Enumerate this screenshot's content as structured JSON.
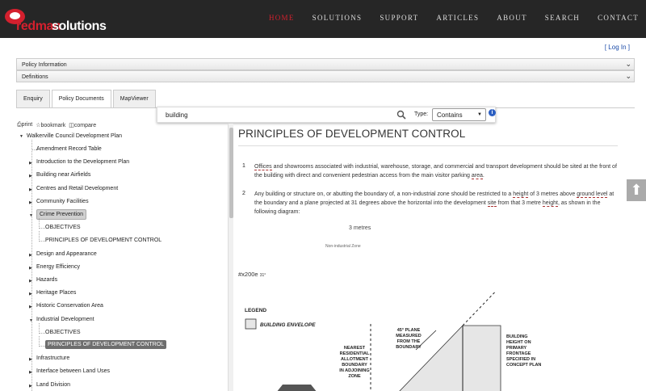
{
  "brand": {
    "red": "redman",
    "white": "solutions",
    "accent": "#d4202e"
  },
  "nav": [
    "HOME",
    "SOLUTIONS",
    "SUPPORT",
    "ARTICLES",
    "ABOUT",
    "SEARCH",
    "CONTACT"
  ],
  "login": "[ Log In ]",
  "accordions": [
    "Policy Information",
    "Definitions"
  ],
  "tabs": [
    "Enquiry",
    "Policy Documents",
    "MapViewer"
  ],
  "search": {
    "value": "building",
    "type_label": "Type:",
    "type_value": "Contains",
    "info": "i"
  },
  "toolbar": {
    "print": "print",
    "bookmark": "bookmark",
    "compare": "compare"
  },
  "tree": {
    "root": "Walkerville Council Development Plan",
    "items": [
      {
        "label": "Amendment Record Table",
        "level": 1,
        "toggle": ""
      },
      {
        "label": "Introduction to the Development Plan",
        "level": 1,
        "toggle": "▶"
      },
      {
        "label": "Building near Airfields",
        "level": 1,
        "toggle": "▶"
      },
      {
        "label": "Centres and Retail Development",
        "level": 1,
        "toggle": "▶"
      },
      {
        "label": "Community Facilities",
        "level": 1,
        "toggle": "▶"
      },
      {
        "label": "Crime Prevention",
        "level": 1,
        "toggle": "▼"
      },
      {
        "label": "OBJECTIVES",
        "level": 2,
        "toggle": ""
      },
      {
        "label": "PRINCIPLES OF DEVELOPMENT CONTROL",
        "level": 2,
        "toggle": ""
      },
      {
        "label": "Design and Appearance",
        "level": 1,
        "toggle": "▶"
      },
      {
        "label": "Energy Efficiency",
        "level": 1,
        "toggle": "▶"
      },
      {
        "label": "Hazards",
        "level": 1,
        "toggle": "▶"
      },
      {
        "label": "Heritage Places",
        "level": 1,
        "toggle": "▶"
      },
      {
        "label": "Historic Conservation Area",
        "level": 1,
        "toggle": "▶"
      },
      {
        "label": "Industrial Development",
        "level": 1,
        "toggle": "▼"
      },
      {
        "label": "OBJECTIVES",
        "level": 2,
        "toggle": ""
      },
      {
        "label": "PRINCIPLES OF DEVELOPMENT CONTROL",
        "level": 2,
        "toggle": ""
      },
      {
        "label": "Infrastructure",
        "level": 1,
        "toggle": "▶"
      },
      {
        "label": "Interface between Land Uses",
        "level": 1,
        "toggle": "▶"
      },
      {
        "label": "Land Division",
        "level": 1,
        "toggle": "▶"
      }
    ]
  },
  "content": {
    "title": "PRINCIPLES OF DEVELOPMENT CONTROL",
    "p1_num": "1",
    "p1_parts": [
      "Offices",
      " and showrooms associated with industrial, warehouse, storage, and commercial and transport development should be sited at the front of the building with direct and convenient pedestrian access from the main visitor parking ",
      "area",
      "."
    ],
    "p2_num": "2",
    "p2_parts": [
      "Any building or structure on, or abutting the boundary of, a non-industrial zone should be restricted to a ",
      "height",
      " of 3 metres above ",
      "ground level",
      " at the boundary and a plane projected at 31 degrees above the horizontal into the development ",
      "site",
      " from that 3 metre ",
      "height",
      ", as shown in the following diagram:"
    ],
    "m3": "3 metres",
    "niz": "Non-industrial Zone",
    "hash": "#x200e",
    "hash_sup": "31°",
    "legend": "LEGEND",
    "envelope": "BUILDING ENVELOPE",
    "nearest": [
      "NEAREST",
      "RESIDENTIAL",
      "ALLOTMENT",
      "BOUNDARY",
      "IN ADJOINING",
      "ZONE"
    ],
    "plane": [
      "45° PLANE",
      "MEASURED",
      "FROM THE",
      "BOUNDARY"
    ],
    "bh": [
      "BUILDING",
      "HEIGHT ON",
      "PRIMARY",
      "FRONTAGE",
      "SPECIFIED IN",
      "CONCEPT PLAN"
    ]
  },
  "scroll_up": "⬆"
}
